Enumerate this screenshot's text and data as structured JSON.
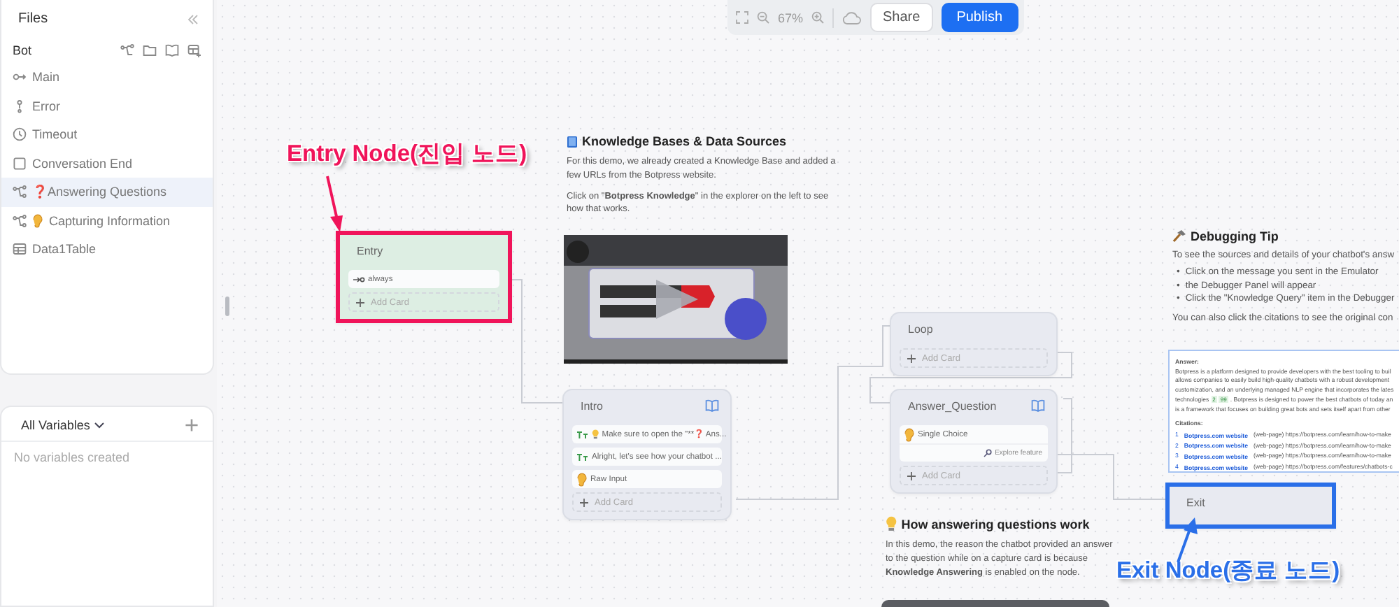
{
  "sidebar": {
    "title": "Files",
    "section": "Bot",
    "items": [
      {
        "label": "Main",
        "kind": "entry",
        "selected": false
      },
      {
        "label": "Error",
        "kind": "error",
        "selected": false
      },
      {
        "label": "Timeout",
        "kind": "timeout",
        "selected": false
      },
      {
        "label": "Conversation End",
        "kind": "end",
        "selected": false
      },
      {
        "label": "❓Answering Questions",
        "kind": "flow",
        "selected": true
      },
      {
        "label": "Capturing Information",
        "kind": "captureflow",
        "selected": false
      },
      {
        "label": "Data1Table",
        "kind": "table",
        "selected": false
      }
    ]
  },
  "variables": {
    "title": "All Variables",
    "empty": "No variables created"
  },
  "toolbar": {
    "zoom": "67%",
    "share": "Share",
    "publish": "Publish"
  },
  "nodes": [
    {
      "kind": "entry",
      "title": "Entry",
      "cards": [
        {
          "kind": "always",
          "text": "always"
        }
      ],
      "add_card": "Add Card"
    },
    {
      "kind": "step",
      "title": "Intro",
      "book": true,
      "cards": [
        {
          "kind": "text",
          "bulb": true,
          "text": "Make sure to open the \"**❓ Ans..."
        },
        {
          "kind": "text",
          "bulb": false,
          "text": "Alright, let's see how your chatbot ..."
        },
        {
          "kind": "capture",
          "bulb": false,
          "text": "Raw Input"
        }
      ],
      "add_card": "Add Card"
    },
    {
      "kind": "step",
      "title": "Loop",
      "book": false,
      "add_card": "Add Card"
    },
    {
      "kind": "step",
      "title": "Answer_Question",
      "book": true,
      "cards": [
        {
          "kind": "capture",
          "bulb": false,
          "text": "Single Choice",
          "footer": "Explore feature"
        }
      ],
      "add_card": "Add Card"
    },
    {
      "kind": "exit",
      "title": "Exit"
    }
  ],
  "annotations": [
    {
      "text": "Entry Node(진입 노드)",
      "color": "#f0145a"
    },
    {
      "text": "Exit Node(종료 노드)",
      "color": "#2a6fe8"
    }
  ],
  "notes": [
    {
      "kind": "knowledge",
      "title": "Knowledge Bases & Data Sources",
      "paragraphs": [
        "For this demo, we already created a Knowledge Base and added a few URLs from the Botpress website.",
        "Click on \"**Botpress Knowledge**\" in the explorer on the left to see how that works."
      ]
    },
    {
      "kind": "tip",
      "title": "Debugging Tip",
      "paragraphs": [
        "To see the sources and details of your chatbot's answ"
      ],
      "bullets": [
        {
          "marker": "•",
          "text": "Click on the message you sent in the Emulator"
        },
        {
          "marker": "•",
          "text": "the Debugger Panel will appear"
        },
        {
          "marker": "•",
          "text": "Click the \"Knowledge Query\" item in the Debugger"
        }
      ],
      "outro": "You can also click the citations to see the original con"
    },
    {
      "kind": "idea",
      "title": "How answering questions work",
      "paragraphs": [
        "In this demo, the reason the chatbot provided an answer to the question while on a capture card is because **Knowledge Answering** is enabled on the node."
      ]
    }
  ],
  "answer": {
    "label": "Answer:",
    "lines": [
      {
        "text": "Botpress is a platform designed to provide developers with the best tooling to buil"
      },
      {
        "text": "allows companies to easily build high-quality chatbots with a robust development"
      },
      {
        "text": "customization, and an underlying managed NLP engine that incorporates the lates"
      },
      {
        "text": "technologies",
        "badges": [
          "2",
          "99"
        ],
        "after": ". Botpress is designed to power the best chatbots of today an"
      },
      {
        "text": "is a framework that focuses on building great bots and sets itself apart from other"
      }
    ],
    "citations_label": "Citations:",
    "citations": [
      {
        "num": "1",
        "source": "Botpress.com website",
        "url": "(web-page) https://botpress.com/learn/how-to-make"
      },
      {
        "num": "2",
        "source": "Botpress.com website",
        "url": "(web-page) https://botpress.com/learn/how-to-make"
      },
      {
        "num": "3",
        "source": "Botpress.com website",
        "url": "(web-page) https://botpress.com/learn/how-to-make"
      },
      {
        "num": "4",
        "source": "Botpress.com website",
        "url": "(web-page) https://botpress.com/features/chatbots-c"
      }
    ]
  }
}
